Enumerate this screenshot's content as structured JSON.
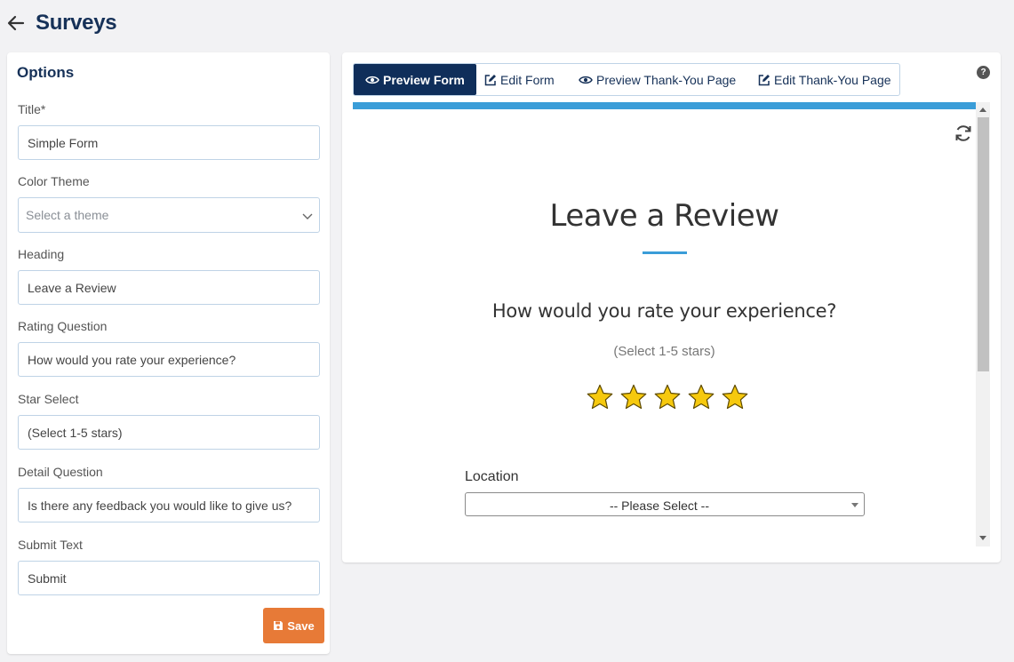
{
  "page": {
    "title": "Surveys"
  },
  "options": {
    "heading": "Options",
    "title_label": "Title*",
    "title_value": "Simple Form",
    "theme_label": "Color Theme",
    "theme_placeholder": "Select a theme",
    "heading_label": "Heading",
    "heading_value": "Leave a Review",
    "rating_label": "Rating Question",
    "rating_value": "How would you rate your experience?",
    "star_label": "Star Select",
    "star_value": "(Select 1-5 stars)",
    "detail_label": "Detail Question",
    "detail_value": "Is there any feedback you would like to give us?",
    "submit_label": "Submit Text",
    "submit_value": "Submit",
    "save_label": "Save"
  },
  "tabs": [
    {
      "label": "Preview Form",
      "icon": "eye-icon",
      "active": true
    },
    {
      "label": "Edit Form",
      "icon": "edit-icon",
      "active": false
    },
    {
      "label": "Preview Thank-You Page",
      "icon": "eye-icon",
      "active": false
    },
    {
      "label": "Edit Thank-You Page",
      "icon": "edit-icon",
      "active": false
    }
  ],
  "help": {
    "label": "?"
  },
  "preview": {
    "heading": "Leave a Review",
    "question": "How would you rate your experience?",
    "hint": "(Select 1-5 stars)",
    "location_label": "Location",
    "location_value": "-- Please Select --"
  },
  "colors": {
    "navy": "#163158",
    "tab_active": "#0f2e5a",
    "accent_blue": "#3a9dd8",
    "save_orange": "#e77a37",
    "star_gold": "#f6c90e"
  }
}
